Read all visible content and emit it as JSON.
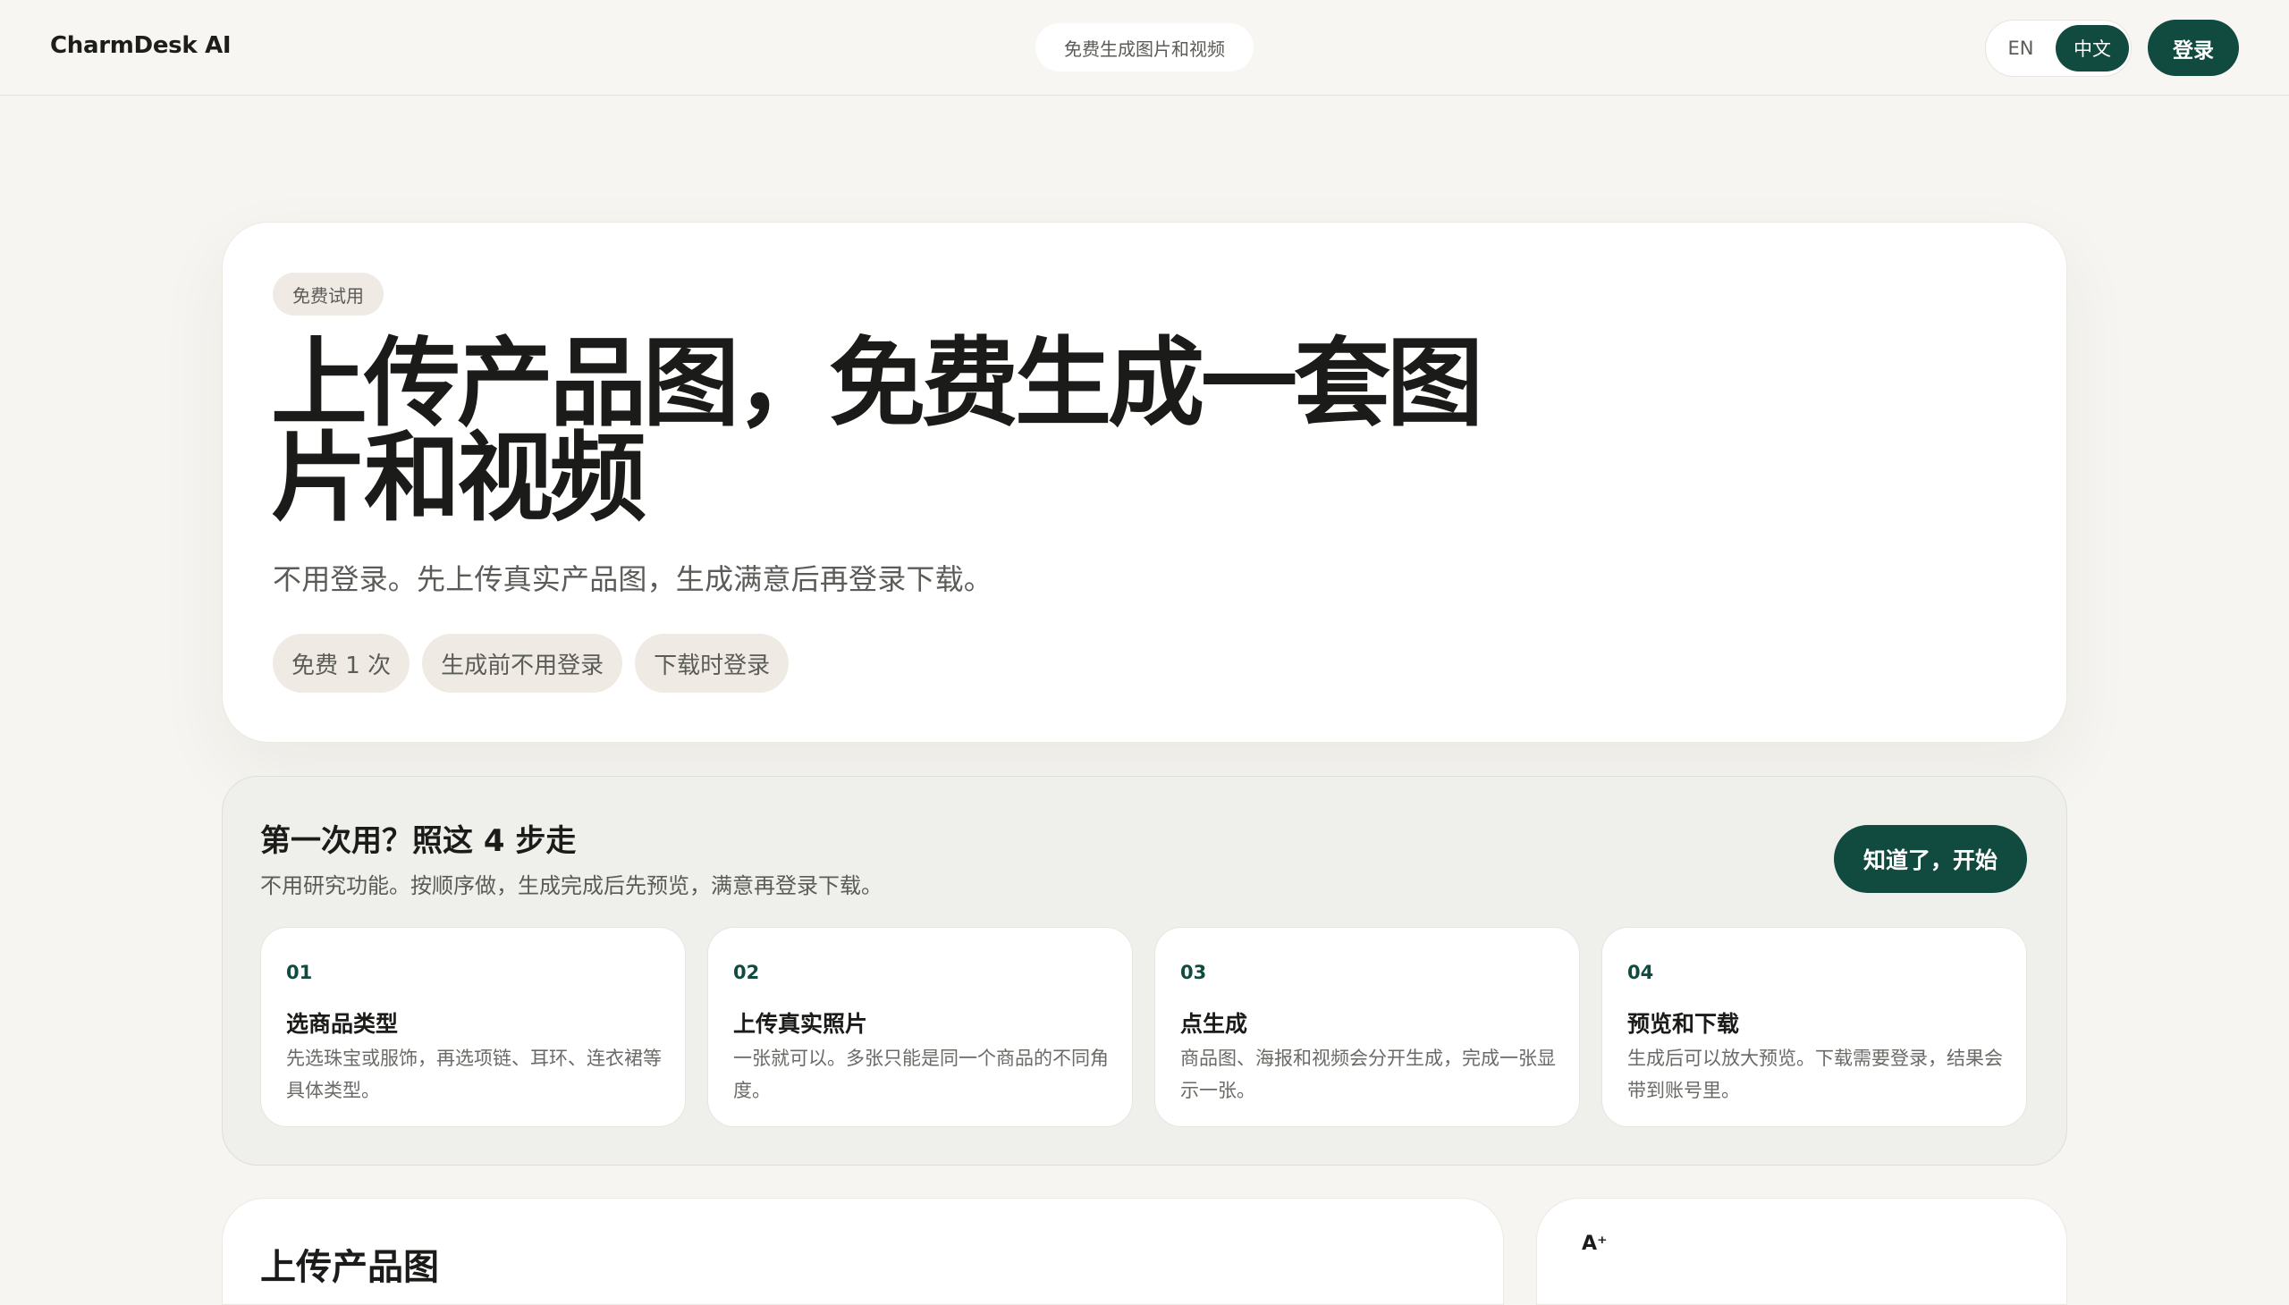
{
  "header": {
    "brand": "CharmDesk AI",
    "center_chip": "免费生成图片和视频",
    "lang_en": "EN",
    "lang_zh": "中文",
    "login": "登录"
  },
  "hero": {
    "badge": "免费试用",
    "title": "上传产品图，免费生成一套图片和视频",
    "subtitle": "不用登录。先上传真实产品图，生成满意后再登录下载。",
    "pills": [
      "免费 1 次",
      "生成前不用登录",
      "下载时登录"
    ]
  },
  "steps": {
    "title": "第一次用？照这 4 步走",
    "subtitle": "不用研究功能。按顺序做，生成完成后先预览，满意再登录下载。",
    "cta": "知道了，开始",
    "items": [
      {
        "num": "01",
        "title": "选商品类型",
        "desc": "先选珠宝或服饰，再选项链、耳环、连衣裙等具体类型。"
      },
      {
        "num": "02",
        "title": "上传真实照片",
        "desc": "一张就可以。多张只能是同一个商品的不同角度。"
      },
      {
        "num": "03",
        "title": "点生成",
        "desc": "商品图、海报和视频会分开生成，完成一张显示一张。"
      },
      {
        "num": "04",
        "title": "预览和下载",
        "desc": "生成后可以放大预览。下载需要登录，结果会带到账号里。"
      }
    ]
  },
  "lower": {
    "left_title": "上传产品图",
    "right_icon": "A⁺"
  },
  "colors": {
    "accent": "#114a3f",
    "background": "#f6f5f1",
    "pill_bg": "#efebe4"
  }
}
